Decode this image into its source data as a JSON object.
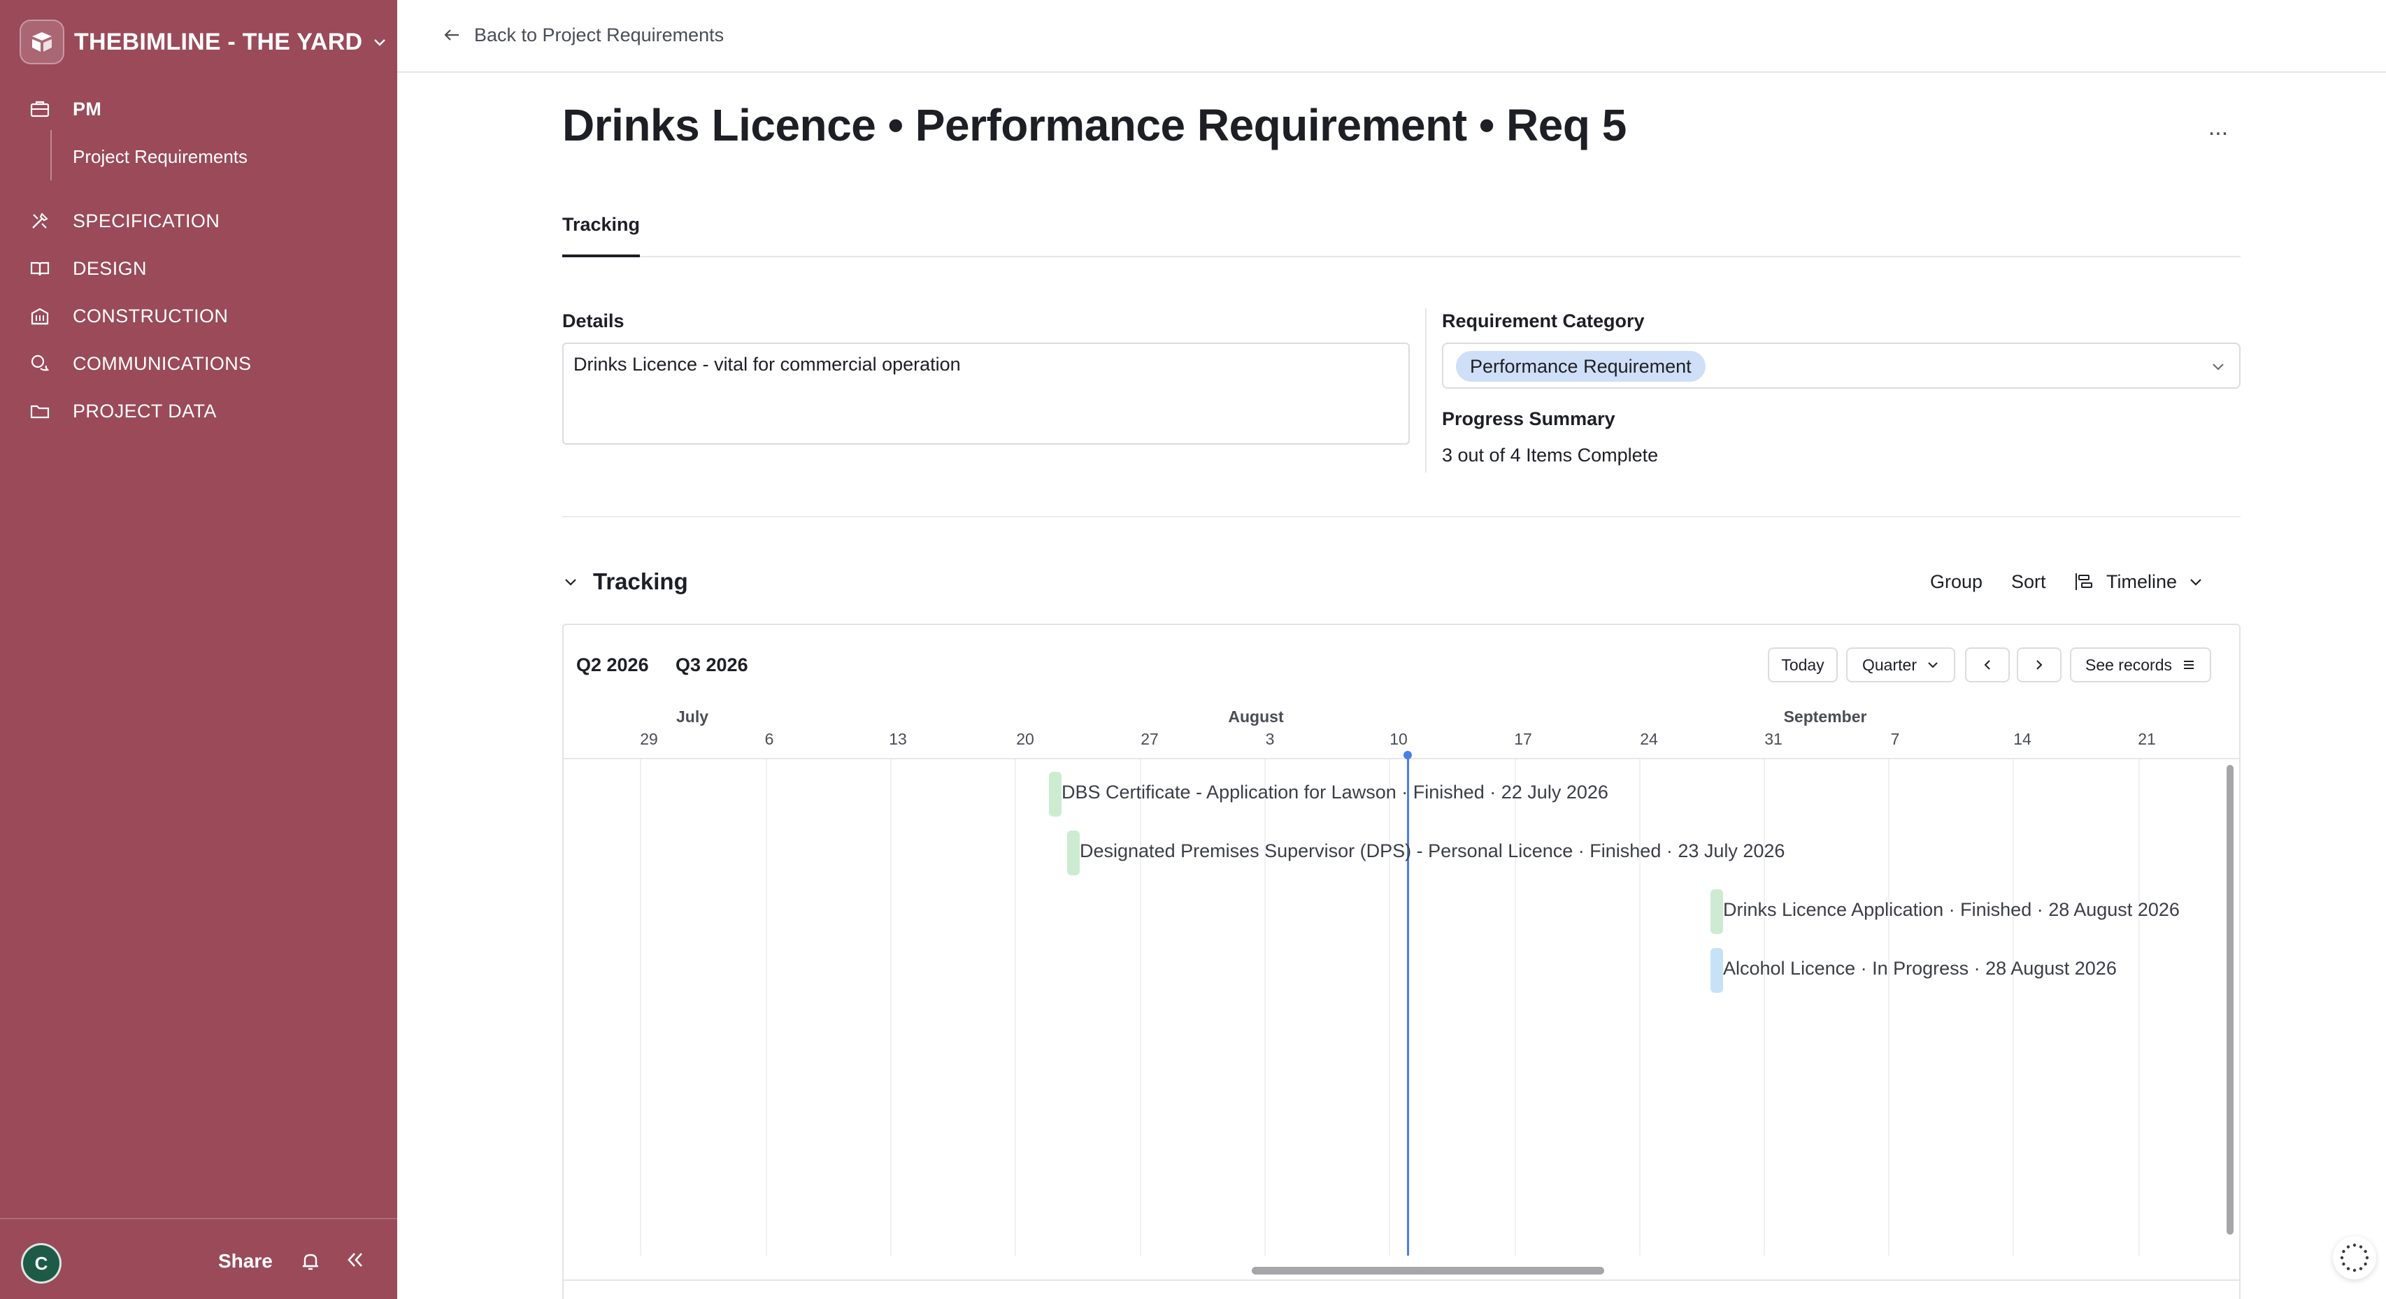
{
  "sidebar": {
    "workspace_name": "THEBIMLINE - THE YARD",
    "nav": [
      {
        "label": "PM",
        "icon": "briefcase-icon"
      },
      {
        "label": "SPECIFICATION",
        "icon": "tools-icon"
      },
      {
        "label": "DESIGN",
        "icon": "book-icon"
      },
      {
        "label": "CONSTRUCTION",
        "icon": "building-icon"
      },
      {
        "label": "COMMUNICATIONS",
        "icon": "chat-icon"
      },
      {
        "label": "PROJECT DATA",
        "icon": "folder-icon"
      }
    ],
    "sub_item": "Project Requirements",
    "footer": {
      "avatar_initial": "C",
      "share_label": "Share"
    },
    "color": "#9a4a59"
  },
  "topbar": {
    "back_label": "Back to Project Requirements"
  },
  "page": {
    "title": "Drinks Licence • Performance Requirement •  Req 5",
    "more_label": "...",
    "tabs": [
      {
        "label": "Tracking"
      }
    ]
  },
  "fields": {
    "details_label": "Details",
    "details_value": "Drinks Licence - vital for commercial operation",
    "category_label": "Requirement Category",
    "category_value": "Performance Requirement",
    "progress_label": "Progress Summary",
    "progress_value": "3 out of 4 Items Complete"
  },
  "tracking": {
    "section_title": "Tracking",
    "group_label": "Group",
    "sort_label": "Sort",
    "view_label": "Timeline",
    "timeline": {
      "quarters": [
        "Q2 2026",
        "Q3 2026"
      ],
      "today_label": "Today",
      "scale_label": "Quarter",
      "see_records_label": "See records",
      "months": [
        "July",
        "August",
        "September"
      ],
      "days": [
        "29",
        "6",
        "13",
        "20",
        "27",
        "3",
        "10",
        "17",
        "24",
        "31",
        "7",
        "14",
        "21"
      ],
      "items": [
        {
          "label": "DBS Certificate - Application for Lawson · Finished · 22 July 2026",
          "status": "finished"
        },
        {
          "label": "Designated Premises Supervisor (DPS) - Personal Licence · Finished · 23 July 2026",
          "status": "finished"
        },
        {
          "label": "Drinks Licence Application · Finished · 28 August 2026",
          "status": "finished"
        },
        {
          "label": "Alcohol Licence · In Progress · 28 August 2026",
          "status": "in-progress"
        }
      ],
      "status_colors": {
        "finished": "#cdebd0",
        "in-progress": "#c7e2f7"
      },
      "today_color": "#4a7fe6"
    }
  }
}
